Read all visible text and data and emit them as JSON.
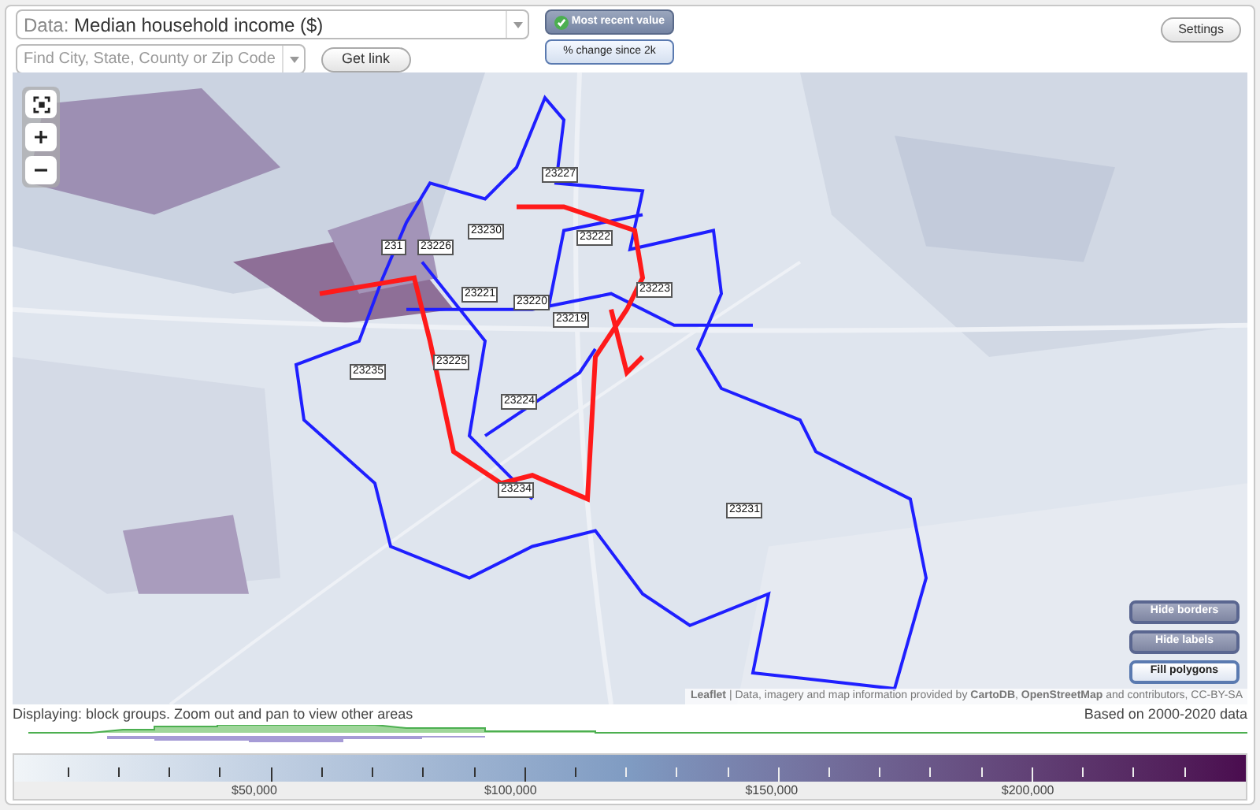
{
  "data_select": {
    "label": "Data:",
    "value": "Median household income ($)"
  },
  "location_search": {
    "placeholder": "Find City, State, County or Zip Code"
  },
  "get_link_button": "Get link",
  "value_modes": [
    {
      "label": "Most recent value",
      "selected": true
    },
    {
      "label": "% change since 2k",
      "selected": false
    }
  ],
  "settings_button": "Settings",
  "map": {
    "zip_labels": [
      "23227",
      "23222",
      "23230",
      "23226",
      "231",
      "23221",
      "23220",
      "23219",
      "23223",
      "23225",
      "23235",
      "23224",
      "23234",
      "23231"
    ],
    "toggles": [
      {
        "label": "Hide borders",
        "selected": true
      },
      {
        "label": "Hide labels",
        "selected": true
      },
      {
        "label": "Fill polygons",
        "selected": false
      }
    ],
    "attribution": "**Leaflet** | Data, imagery and map information provided by **CartoDB**, **OpenStreetMap** and contributors, CC-BY-SA"
  },
  "displaying_note": "Displaying: block groups. Zoom out and pan to view other areas",
  "data_range_note": "Based on 2000-2020 data",
  "legend": {
    "labels": [
      "$50,000",
      "$100,000",
      "$150,000",
      "$200,000"
    ]
  }
}
